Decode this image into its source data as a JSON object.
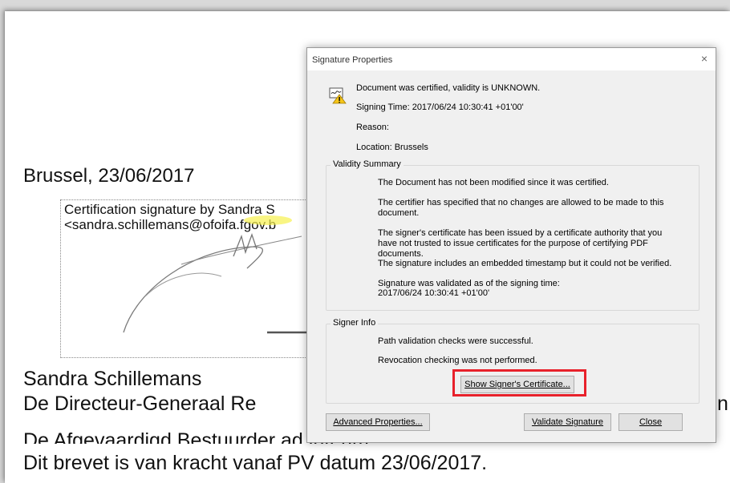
{
  "document": {
    "place_date": "Brussel, 23/06/2017",
    "sig_line1": "Certification signature by Sandra S",
    "sig_line2": "<sandra.schillemans@ofoifa.fgov.b",
    "name": "Sandra Schillemans",
    "title1": "De Directeur-Generaal Re",
    "title1_tail": "n",
    "title2": "De Afgevaardigd Bestuurder ad interim",
    "note": "Dit brevet is van kracht vanaf PV datum 23/06/2017."
  },
  "dialog": {
    "title": "Signature Properties",
    "close_glyph": "×",
    "status": "Document was certified, validity is UNKNOWN.",
    "signing_time": "Signing Time:  2017/06/24 10:30:41 +01'00'",
    "reason": "Reason:",
    "location": "Location:  Brussels",
    "validity": {
      "legend": "Validity Summary",
      "items": [
        "The Document has not been modified since it was certified.",
        "The certifier has specified that no changes are allowed to be made to this document.",
        "The signer's certificate has been issued by a certificate authority that you have not trusted to issue certificates for the purpose of certifying PDF documents.",
        "The signature includes an embedded timestamp but it could not be verified.",
        "Signature was validated as of the signing time:",
        "2017/06/24 10:30:41 +01'00'"
      ]
    },
    "signer": {
      "legend": "Signer Info",
      "items": [
        "Path validation checks were successful.",
        "Revocation checking was not performed."
      ],
      "show_cert_label": "Show Signer's Certificate..."
    },
    "buttons": {
      "advanced": "Advanced Properties...",
      "validate": "Validate Signature",
      "close": "Close"
    }
  },
  "colors": {
    "highlight": "#e8212b",
    "dialog_body": "#f0f0f0"
  }
}
